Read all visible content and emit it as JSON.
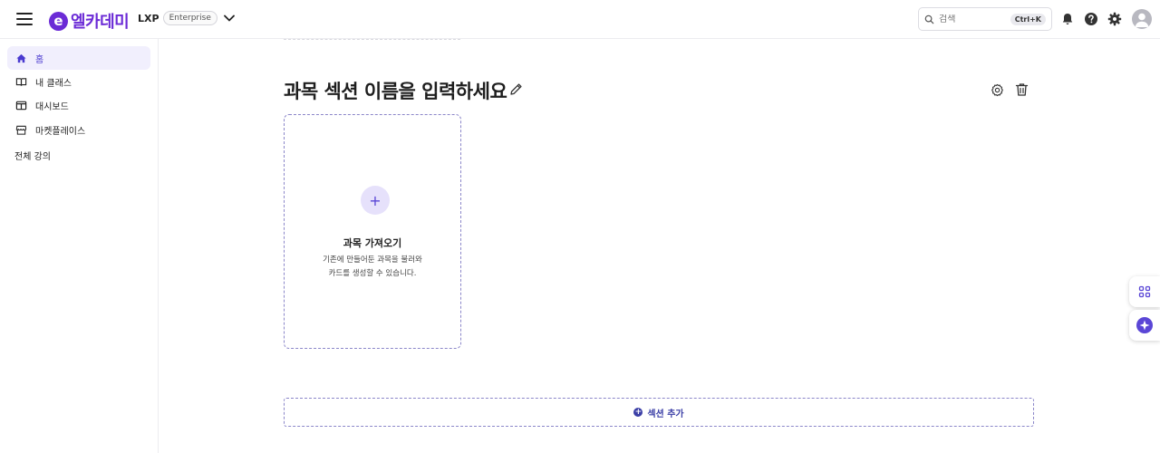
{
  "header": {
    "logo_mark": "e",
    "logo_text": "엘카데미",
    "product_name": "LXP",
    "product_badge": "Enterprise",
    "search_placeholder": "검색",
    "search_shortcut": "Ctrl+K"
  },
  "sidebar": {
    "items": [
      {
        "label": "홈",
        "icon": "home-icon",
        "active": true
      },
      {
        "label": "내 클래스",
        "icon": "book-icon",
        "active": false
      },
      {
        "label": "대시보드",
        "icon": "dashboard-icon",
        "active": false
      },
      {
        "label": "마켓플레이스",
        "icon": "store-icon",
        "active": false
      }
    ],
    "all_courses": "전체 강의"
  },
  "main": {
    "section_title": "과목 섹션 이름을 입력하세요",
    "import_card": {
      "plus": "+",
      "title": "과목 가져오기",
      "desc_line1": "기존에 만들어둔 과목을 불러와",
      "desc_line2": "카드를 생성할 수 있습니다."
    },
    "add_section_label": "섹션 추가",
    "add_section_plus": "+"
  },
  "colors": {
    "brand": "#6b2bd6",
    "active_bg": "#f1effd",
    "accent": "#3b3fa6"
  }
}
